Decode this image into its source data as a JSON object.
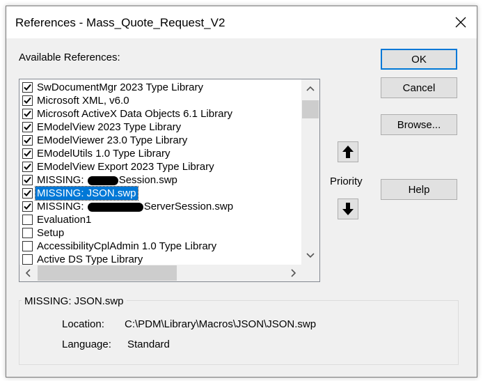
{
  "window": {
    "title": "References - Mass_Quote_Request_V2"
  },
  "available_label": "Available References:",
  "references": [
    {
      "label": "SwDocumentMgr 2023 Type Library",
      "checked": true,
      "selected": false
    },
    {
      "label": "Microsoft XML, v6.0",
      "checked": true,
      "selected": false
    },
    {
      "label": "Microsoft ActiveX Data Objects 6.1 Library",
      "checked": true,
      "selected": false
    },
    {
      "label": "EModelView 2023 Type Library",
      "checked": true,
      "selected": false
    },
    {
      "label": "EModelViewer 23.0 Type Library",
      "checked": true,
      "selected": false
    },
    {
      "label": "EModelUtils 1.0 Type Library",
      "checked": true,
      "selected": false
    },
    {
      "label": "EModelView Export 2023 Type Library",
      "checked": true,
      "selected": false
    },
    {
      "label_prefix": "MISSING: ",
      "label_suffix": "Session.swp",
      "redacted": true,
      "checked": true,
      "selected": false
    },
    {
      "label": "MISSING: JSON.swp",
      "checked": true,
      "selected": true
    },
    {
      "label_prefix": "MISSING: ",
      "label_suffix": "ServerSession.swp",
      "redacted": true,
      "checked": true,
      "selected": false
    },
    {
      "label": "Evaluation1",
      "checked": false,
      "selected": false
    },
    {
      "label": "Setup",
      "checked": false,
      "selected": false
    },
    {
      "label": "AccessibilityCplAdmin 1.0 Type Library",
      "checked": false,
      "selected": false
    },
    {
      "label": "Active DS Type Library",
      "checked": false,
      "selected": false
    }
  ],
  "buttons": {
    "ok": "OK",
    "cancel": "Cancel",
    "browse": "Browse...",
    "help": "Help"
  },
  "priority_label": "Priority",
  "details": {
    "title": "MISSING: JSON.swp",
    "location_label": "Location:",
    "location_value": "C:\\PDM\\Library\\Macros\\JSON\\JSON.swp",
    "language_label": "Language:",
    "language_value": "Standard"
  },
  "colors": {
    "selection": "#0078d7",
    "default_button_border": "#0078d7",
    "dialog_bg": "#f0f0f0"
  }
}
